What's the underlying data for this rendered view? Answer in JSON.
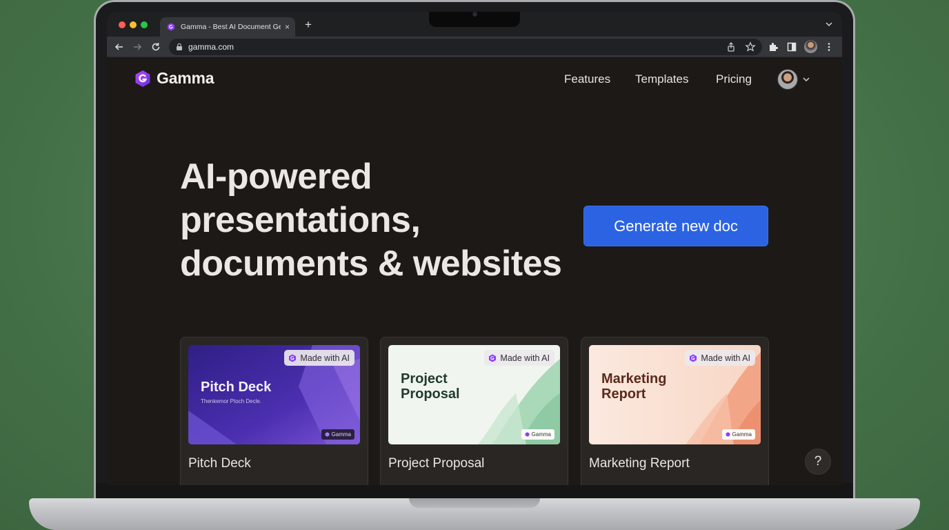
{
  "browser": {
    "tab_title": "Gamma - Best AI Document Generator",
    "tab_close": "×",
    "new_tab": "+",
    "url": "gamma.com"
  },
  "header": {
    "logo_text": "Gamma",
    "nav": [
      "Features",
      "Templates",
      "Pricing"
    ]
  },
  "hero": {
    "lines": [
      "AI-powered",
      "presentations,",
      "documents & websites"
    ],
    "cta_label": "Generate new doc"
  },
  "cards": [
    {
      "label": "Pitch Deck",
      "thumb_title": "Pitch Deck",
      "thumb_subtitle": "Thenkemor Ptoch Decle.",
      "badge": "Made with AI",
      "mini_badge": "Gamma"
    },
    {
      "label": "Project Proposal",
      "thumb_title_lines": [
        "Project",
        "Proposal"
      ],
      "badge": "Made with AI",
      "mini_badge": "Gamma"
    },
    {
      "label": "Marketing Report",
      "thumb_title_lines": [
        "Marketing",
        "Report"
      ],
      "badge": "Made with AI",
      "mini_badge": "Gamma"
    }
  ],
  "help_label": "?",
  "colors": {
    "page_bg": "#1c1917",
    "cta_blue": "#2b63e3",
    "brand_purple": "#8b3dff"
  },
  "icons": {
    "logo": "gamma-logo-icon",
    "avatar": "user-avatar",
    "caret": "chevron-down-icon"
  }
}
